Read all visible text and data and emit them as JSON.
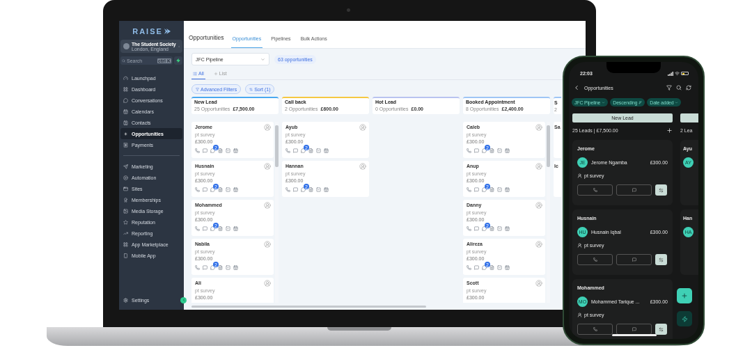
{
  "laptop": {
    "sidebar": {
      "logo": "RAISE",
      "account": {
        "name": "The Student Society",
        "location": "London, England"
      },
      "search": {
        "placeholder": "Search",
        "shortcut": "ctrl K"
      },
      "primary_items": [
        {
          "label": "Launchpad",
          "selected": false
        },
        {
          "label": "Dashboard",
          "selected": false
        },
        {
          "label": "Conversations",
          "selected": false
        },
        {
          "label": "Calendars",
          "selected": false
        },
        {
          "label": "Contacts",
          "selected": false
        },
        {
          "label": "Opportunities",
          "selected": true
        },
        {
          "label": "Payments",
          "selected": false
        }
      ],
      "secondary_items": [
        {
          "label": "Marketing",
          "selected": false
        },
        {
          "label": "Automation",
          "selected": false
        },
        {
          "label": "Sites",
          "selected": false
        },
        {
          "label": "Memberships",
          "selected": false
        },
        {
          "label": "Media Storage",
          "selected": false
        },
        {
          "label": "Reputation",
          "selected": false
        },
        {
          "label": "Reporting",
          "selected": false
        },
        {
          "label": "App Marketplace",
          "selected": false
        },
        {
          "label": "Mobile App",
          "selected": false
        }
      ],
      "settings": "Settings"
    },
    "header": {
      "title": "Opportunities",
      "tabs": [
        {
          "label": "Opportunities",
          "selected": true
        },
        {
          "label": "Pipelines",
          "selected": false
        },
        {
          "label": "Bulk Actions",
          "selected": false
        }
      ]
    },
    "pipeline": {
      "value": "JFC Pipeline",
      "count": "63 opportunities"
    },
    "views": [
      {
        "label": "All",
        "selected": true
      },
      {
        "label": "List",
        "selected": false
      }
    ],
    "filters": [
      "Advanced Filters",
      "Sort (1)"
    ],
    "columns": [
      {
        "kind": "full",
        "title": "New Lead",
        "count": "25 Opportunities",
        "total": "£7,500.00",
        "color": "#4aa8f0",
        "cards": [
          {
            "kind": "full",
            "name": "Jerome",
            "source": "pt survey",
            "value": "£300.00",
            "badge": "2"
          },
          {
            "kind": "full",
            "name": "Husnain",
            "source": "pt survey",
            "value": "£300.00",
            "badge": "2"
          },
          {
            "kind": "full",
            "name": "Mohammed",
            "source": "pt survey",
            "value": "£300.00",
            "badge": "2"
          },
          {
            "kind": "full",
            "name": "Nabila",
            "source": "pt survey",
            "value": "£300.00",
            "badge": "2"
          },
          {
            "kind": "cut",
            "name": "Ali",
            "source": "pt survey",
            "value": "£300.00"
          }
        ]
      },
      {
        "kind": "full",
        "title": "Call back",
        "count": "2 Opportunities",
        "total": "£600.00",
        "color": "#f5c842",
        "cards": [
          {
            "kind": "full",
            "name": "Ayub",
            "source": "pt survey",
            "value": "£300.00",
            "badge": "2"
          },
          {
            "kind": "full",
            "name": "Hannan",
            "source": "pt survey",
            "value": "£300.00",
            "badge": "2"
          }
        ]
      },
      {
        "kind": "full",
        "title": "Hot Lead",
        "count": "0 Opportunities",
        "total": "£0.00",
        "color": "#b9c3f0"
      },
      {
        "kind": "full",
        "title": "Booked Appointment",
        "count": "8 Opportunities",
        "total": "£2,400.00",
        "color": "#9ec5f5",
        "cards": [
          {
            "kind": "full",
            "name": "Caleb",
            "source": "pt survey",
            "value": "£300.00",
            "badge": "2"
          },
          {
            "kind": "full",
            "name": "Anup",
            "source": "pt survey",
            "value": "£300.00",
            "badge": "2"
          },
          {
            "kind": "full",
            "name": "Danny",
            "source": "pt survey",
            "value": "£300.00",
            "badge": "2"
          },
          {
            "kind": "full",
            "name": "Alireza",
            "source": "pt survey",
            "value": "£300.00",
            "badge": "2"
          },
          {
            "kind": "cut",
            "name": "Scott",
            "source": "pt survey",
            "value": "£300.00"
          }
        ]
      },
      {
        "kind": "sliver",
        "title": "S",
        "count": "2",
        "color": "#9ec5f5",
        "cards": [
          {
            "kind": "sliver",
            "name": "Sa"
          },
          {
            "kind": "sliver",
            "name": "Ic"
          }
        ]
      }
    ]
  },
  "phone": {
    "time": "22:03",
    "title": "Opportunities",
    "chips": [
      "JFC Pipeline",
      "Descending",
      "Date added"
    ],
    "stage": "New Lead",
    "summary": "25 Leads | £7,500.00",
    "next_summary": "2 Lea",
    "leads": [
      {
        "title": "Jerome",
        "initials": "JE",
        "contact": "Jerome Ngamba",
        "value": "£300.00",
        "source": "pt survey"
      },
      {
        "title": "Husnain",
        "initials": "HU",
        "contact": "Husnain Iqbal",
        "value": "£300.00",
        "source": "pt survey"
      },
      {
        "title": "Mohammed",
        "initials": "MO",
        "contact": "Mohammed Tarique ...",
        "value": "£300.00",
        "source": "pt survey"
      }
    ],
    "next_leads": [
      {
        "title": "Ayu",
        "initials": "AY"
      },
      {
        "title": "Han",
        "initials": "HA"
      }
    ]
  }
}
